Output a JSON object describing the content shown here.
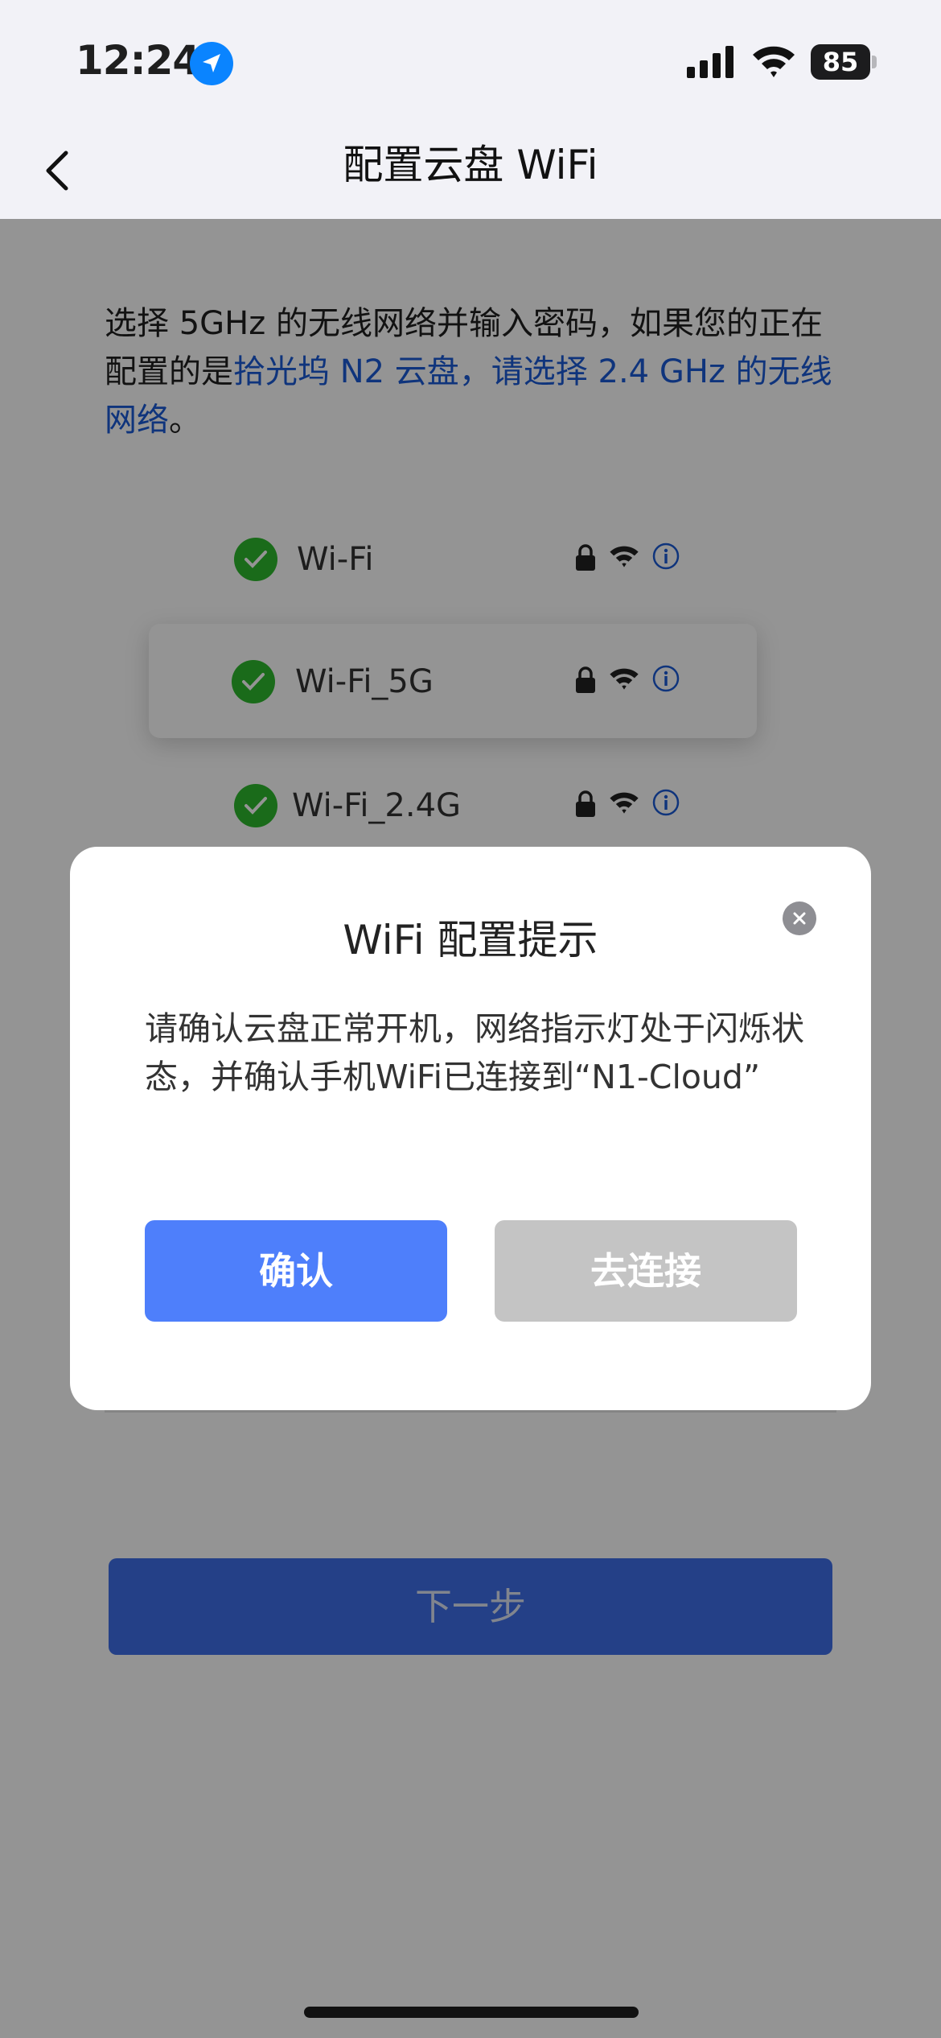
{
  "status_bar": {
    "time": "12:24",
    "battery": "85",
    "location_icon": "location-arrow-icon",
    "signal_icon": "cellular-signal-icon",
    "wifi_icon": "wifi-icon"
  },
  "nav": {
    "title": "配置云盘 WiFi",
    "back_icon": "chevron-left-icon"
  },
  "instruction": {
    "text_plain": "选择 5GHz 的无线网络并输入密码，如果您的正在配置的是",
    "text_highlight": "拾光坞 N2 云盘，请选择 2.4 GHz 的无线网络",
    "text_end": "。"
  },
  "wifi_list": [
    {
      "ssid": "Wi-Fi"
    },
    {
      "ssid": "Wi-Fi_5G",
      "selected": true
    },
    {
      "ssid": "Wi-Fi_2.4G"
    }
  ],
  "next_button": {
    "label": "下一步"
  },
  "dialog": {
    "title": "WiFi 配置提示",
    "message": "请确认云盘正常开机，网络指示灯处于闪烁状态，并确认手机WiFi已连接到“N1-Cloud”",
    "confirm_label": "确认",
    "connect_label": "去连接",
    "close_icon": "close-icon"
  },
  "colors": {
    "accent_blue": "#4e7ffb",
    "link_blue": "#1a5bd6",
    "check_green": "#2eb82e",
    "disabled_gray": "#c4c4c4"
  }
}
